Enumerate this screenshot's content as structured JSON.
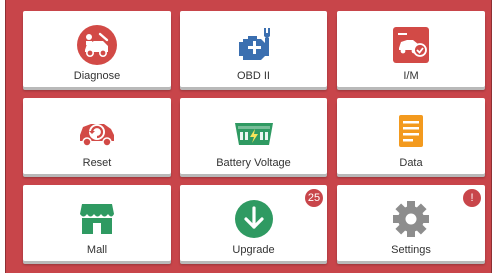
{
  "colors": {
    "background": "#c8454a",
    "tile": "#ffffff",
    "red": "#d24a46",
    "blue": "#3b6fb0",
    "green": "#2f9a62",
    "orange": "#f39a1e",
    "gray": "#8d8d8d",
    "badge": "#c8454a"
  },
  "tiles": [
    {
      "label": "Diagnose",
      "icon": "car-diagnose-icon"
    },
    {
      "label": "OBD II",
      "icon": "engine-wrench-icon"
    },
    {
      "label": "I/M",
      "icon": "car-check-icon"
    },
    {
      "label": "Reset",
      "icon": "car-reset-icon"
    },
    {
      "label": "Battery Voltage",
      "icon": "battery-icon"
    },
    {
      "label": "Data",
      "icon": "document-icon"
    },
    {
      "label": "Mall",
      "icon": "store-icon"
    },
    {
      "label": "Upgrade",
      "icon": "download-arrow-icon",
      "badge": "25"
    },
    {
      "label": "Settings",
      "icon": "gear-icon",
      "badge": "!"
    }
  ]
}
